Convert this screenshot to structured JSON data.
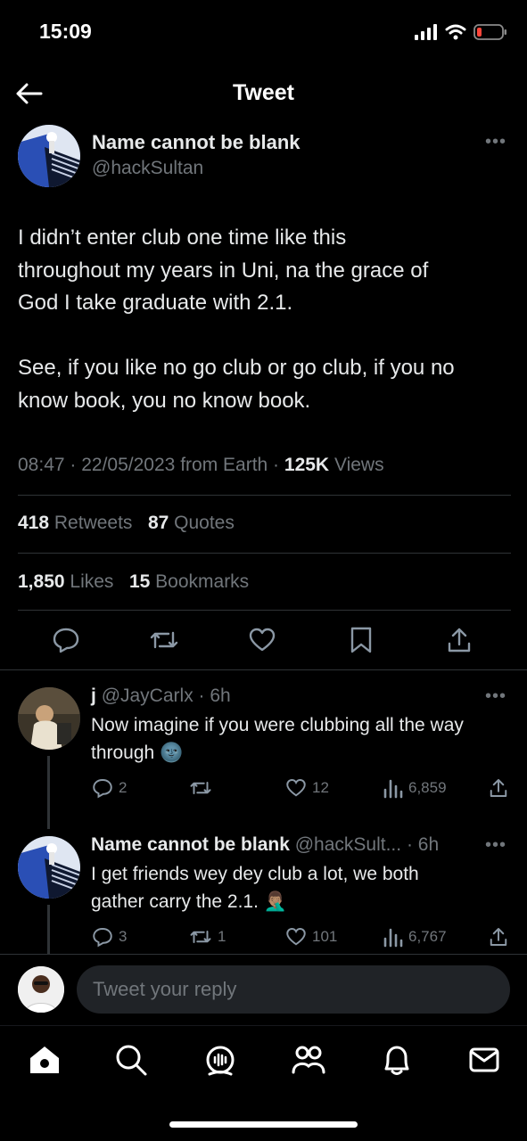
{
  "status_bar": {
    "time": "15:09"
  },
  "header": {
    "title": "Tweet"
  },
  "tweet": {
    "display_name": "Name cannot be blank",
    "handle": "@hackSultan",
    "paragraph1_line1": "I didn’t enter club one time like this",
    "paragraph1_line2": "throughout my years in Uni, na the grace of",
    "paragraph1_line3": "God I take graduate with 2.1.",
    "paragraph2_line1": "See, if you like no go club or go club, if you no",
    "paragraph2_line2": "know book, you no know book.",
    "time": "08:47",
    "date": "22/05/2023",
    "source": "from Earth",
    "views_count": "125K",
    "views_label": "Views",
    "retweets_count": "418",
    "retweets_label": "Retweets",
    "quotes_count": "87",
    "quotes_label": "Quotes",
    "likes_count": "1,850",
    "likes_label": "Likes",
    "bookmarks_count": "15",
    "bookmarks_label": "Bookmarks"
  },
  "replies": [
    {
      "name": "j",
      "handle": "@JayCarlx",
      "age": "6h",
      "line1": "Now imagine if you were clubbing all the way",
      "line2": "through",
      "emoji": "🌚",
      "replies": "2",
      "retweets": "",
      "likes": "12",
      "views": "6,859"
    },
    {
      "name": "Name cannot be blank",
      "handle": "@hackSult...",
      "age": "6h",
      "line1": "I get friends wey dey club a lot, we both",
      "line2": "gather carry the 2.1.",
      "emoji": "🤦🏽‍♂️",
      "replies": "3",
      "retweets": "1",
      "likes": "101",
      "views": "6,767"
    }
  ],
  "composer": {
    "placeholder": "Tweet your reply"
  },
  "colors": {
    "background": "#000000",
    "text": "#e7e9ea",
    "muted": "#71767b",
    "divider": "#2f3336"
  },
  "icons": [
    "back-arrow-icon",
    "reply-icon",
    "retweet-icon",
    "like-icon",
    "bookmark-icon",
    "share-icon",
    "views-icon",
    "home-icon",
    "search-icon",
    "spaces-icon",
    "communities-icon",
    "notifications-icon",
    "messages-icon"
  ]
}
